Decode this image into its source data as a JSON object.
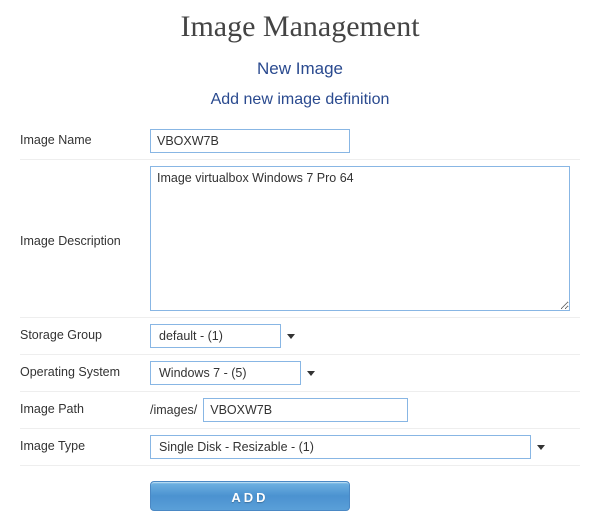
{
  "page": {
    "title": "Image Management",
    "subtitle": "New Image",
    "section_title": "Add new image definition"
  },
  "form": {
    "labels": {
      "image_name": "Image Name",
      "image_description": "Image Description",
      "storage_group": "Storage Group",
      "operating_system": "Operating System",
      "image_path": "Image Path",
      "image_type": "Image Type"
    },
    "values": {
      "image_name": "VBOXW7B",
      "image_description": "Image virtualbox Windows 7 Pro 64",
      "storage_group": "default - (1)",
      "operating_system": "Windows 7 - (5)",
      "image_path_prefix": "/images/",
      "image_path": "VBOXW7B",
      "image_type": "Single Disk - Resizable - (1)"
    },
    "buttons": {
      "submit": "Add"
    }
  }
}
